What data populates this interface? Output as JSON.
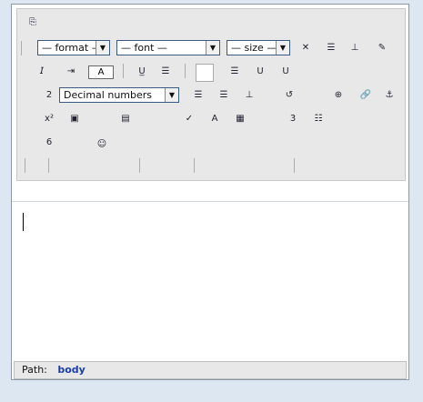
{
  "toolbar": {
    "format_select": "— format —",
    "font_select": "— font —",
    "size_select": "— size —",
    "list_style_select": "Decimal numbers",
    "text_color_label": "A"
  },
  "status": {
    "path_label": "Path:",
    "path_tag": "body"
  },
  "icons": {
    "dropdown_arrow": "▼"
  }
}
